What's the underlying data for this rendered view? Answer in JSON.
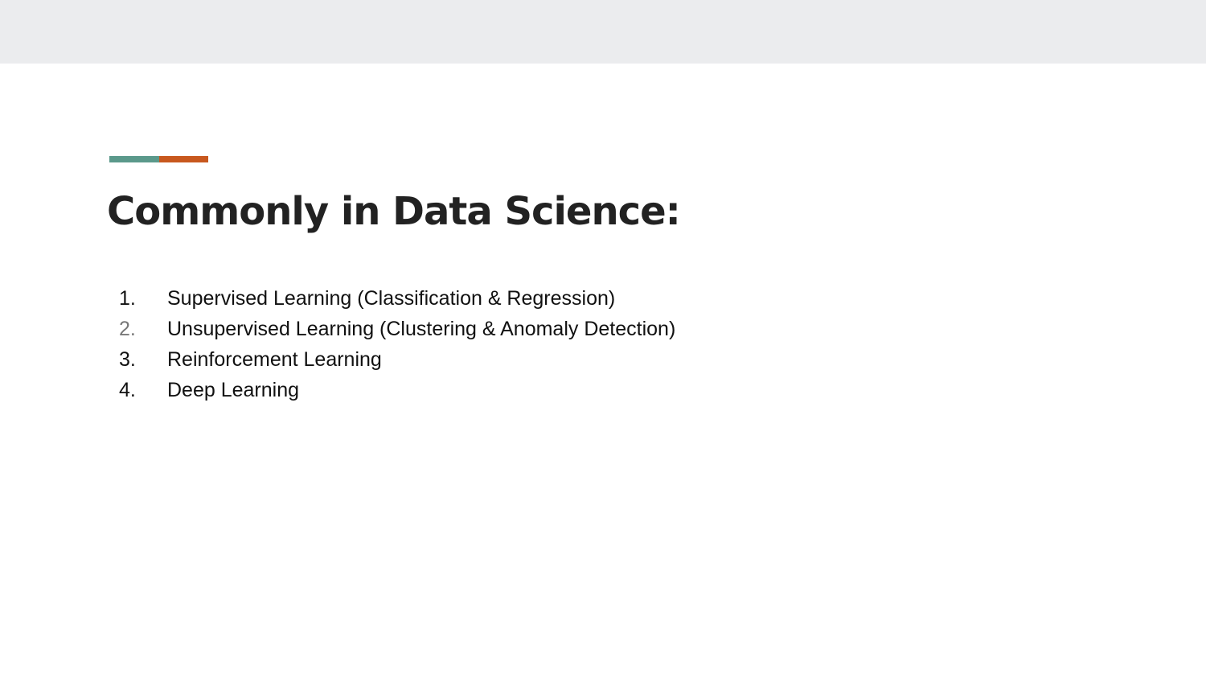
{
  "theme": {
    "header_band_color": "#ebecee",
    "accent_teal": "#5b998b",
    "accent_orange": "#c8581e",
    "text_color": "#111111",
    "title_color": "#222222"
  },
  "slide": {
    "title": "Commonly in Data Science:",
    "items": [
      {
        "number": "1.",
        "label": "Supervised Learning (Classification & Regression)"
      },
      {
        "number": "2.",
        "label": "Unsupervised Learning (Clustering & Anomaly Detection)"
      },
      {
        "number": "3.",
        "label": "Reinforcement Learning"
      },
      {
        "number": "4.",
        "label": "Deep Learning"
      }
    ]
  }
}
